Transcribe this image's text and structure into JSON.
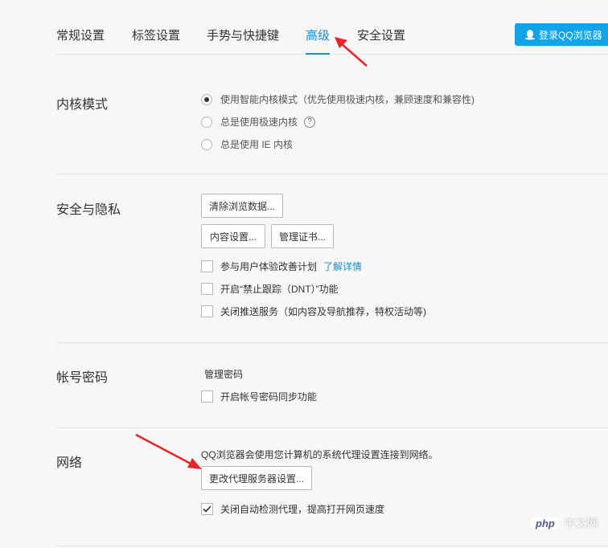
{
  "tabs": [
    {
      "label": "常规设置",
      "active": false
    },
    {
      "label": "标签设置",
      "active": false
    },
    {
      "label": "手势与快捷键",
      "active": false
    },
    {
      "label": "高级",
      "active": true
    },
    {
      "label": "安全设置",
      "active": false
    }
  ],
  "login_button": {
    "label": "登录QQ浏览器",
    "icon": "penguin-icon"
  },
  "kernel": {
    "title": "内核模式",
    "options": [
      {
        "label": "使用智能内核模式（优先使用极速内核，兼顾速度和兼容性)",
        "selected": true
      },
      {
        "label": "总是使用极速内核",
        "selected": false
      },
      {
        "label": "总是使用 IE 内核",
        "selected": false
      }
    ],
    "help_glyph": "?"
  },
  "privacy": {
    "title": "安全与隐私",
    "clear_button": "清除浏览数据...",
    "content_button": "内容设置...",
    "cert_button": "管理证书...",
    "checks": [
      {
        "label": "参与用户体验改善计划",
        "checked": false
      },
      {
        "label": "开启“禁止跟踪（DNT）”功能",
        "checked": false
      },
      {
        "label": "关闭推送服务（如内容及导航推荐，特权活动等)",
        "checked": false
      }
    ],
    "learn_more": "了解详情"
  },
  "account": {
    "title": "帐号密码",
    "manage_link": "管理密码",
    "sync_check": {
      "label": "开启帐号密码同步功能",
      "checked": false
    }
  },
  "network": {
    "title": "网络",
    "description": "QQ浏览器会使用您计算机的系统代理设置连接到网络。",
    "proxy_button": "更改代理服务器设置...",
    "auto_detect": {
      "label": "关闭自动检测代理，提高打开网页速度",
      "checked": true
    }
  },
  "watermark": {
    "php": "php",
    "cn": "中文网"
  },
  "colors": {
    "accent": "#1a8cd8",
    "login": "#12a3e8",
    "arrow": "#e8262a"
  }
}
